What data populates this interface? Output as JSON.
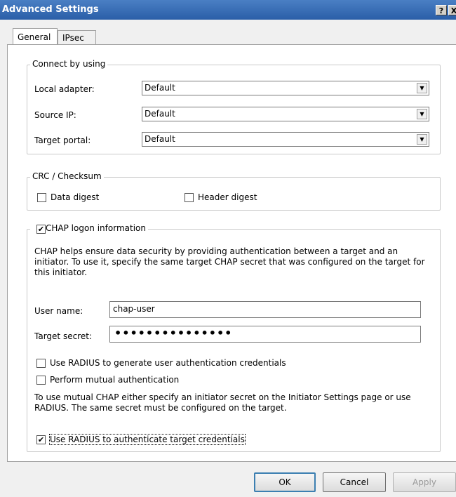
{
  "window": {
    "title": "Advanced Settings",
    "help_label": "?",
    "close_label": "X"
  },
  "tabs": [
    {
      "label": "General"
    },
    {
      "label": "IPsec"
    }
  ],
  "connect": {
    "legend": "Connect by using",
    "local_adapter": {
      "label": "Local adapter:",
      "value": "Default"
    },
    "source_ip": {
      "label": "Source IP:",
      "value": "Default"
    },
    "target_portal": {
      "label": "Target portal:",
      "value": "Default"
    }
  },
  "crc": {
    "legend": "CRC / Checksum",
    "data_digest": {
      "label": "Data digest",
      "checked": false
    },
    "header_digest": {
      "label": "Header digest",
      "checked": false
    }
  },
  "chap": {
    "legend": "CHAP logon information",
    "checked": true,
    "description": "CHAP helps ensure data security by providing authentication between a target and an initiator. To use it, specify the same target CHAP secret that was configured on the target for this initiator.",
    "user_name": {
      "label": "User name:",
      "value": "chap-user"
    },
    "target_secret": {
      "label": "Target secret:",
      "value": "•••••••••••••••"
    },
    "use_radius_generate": {
      "label": "Use RADIUS to generate user authentication credentials",
      "checked": false
    },
    "mutual_auth": {
      "label": "Perform mutual authentication",
      "checked": false
    },
    "mutual_note": "To use mutual CHAP either specify an initiator secret on the Initiator Settings page or use RADIUS.  The same secret must be configured on the target.",
    "use_radius_authenticate": {
      "label": "Use RADIUS to authenticate target credentials",
      "checked": true
    }
  },
  "buttons": {
    "ok": "OK",
    "cancel": "Cancel",
    "apply": "Apply"
  },
  "glyphs": {
    "check": "✔",
    "arrow": "▼"
  }
}
